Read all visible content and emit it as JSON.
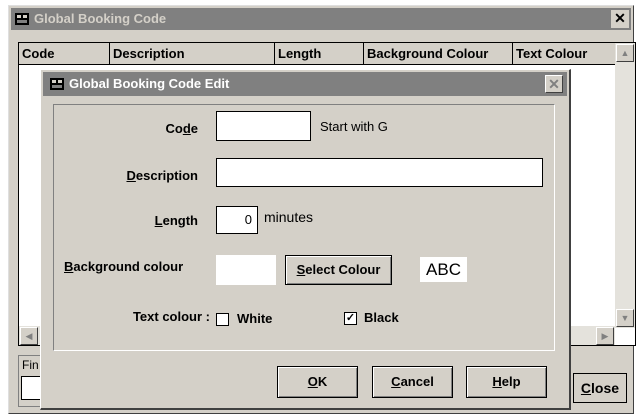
{
  "outer_window": {
    "title": "Global Booking Code",
    "close_glyph": "✕",
    "columns": [
      "Code",
      "Description",
      "Length",
      "Background Colour",
      "Text Colour"
    ],
    "find_label": "Fin",
    "close_button_label": "Close",
    "close_button_mnemonic": "C",
    "close_button_rest": "lose"
  },
  "dialog": {
    "title": "Global Booking Code Edit",
    "close_glyph": "✕",
    "code": {
      "label_pre": "Co",
      "label_mnemonic": "d",
      "label_post": "e",
      "value": "",
      "hint": "Start with G"
    },
    "description": {
      "label_mnemonic": "D",
      "label_post": "escription",
      "value": ""
    },
    "length": {
      "label_mnemonic": "L",
      "label_post": "ength",
      "value": "0",
      "unit": "minutes"
    },
    "background_colour": {
      "label_mnemonic": "B",
      "label_post": "ackground colour",
      "select_button_mnemonic": "S",
      "select_button_rest": "elect Colour",
      "preview_text": "ABC"
    },
    "text_colour": {
      "label": "Text colour :",
      "options": [
        {
          "label": "White",
          "checked": false
        },
        {
          "label": "Black",
          "checked": true
        }
      ]
    },
    "buttons": {
      "ok": {
        "mnemonic": "O",
        "rest": "K"
      },
      "cancel": {
        "mnemonic": "C",
        "rest": "ancel"
      },
      "help": {
        "mnemonic": "H",
        "rest": "elp"
      }
    }
  },
  "colors": {
    "title_bar_inactive": "#808080",
    "face": "#d4d0c8"
  }
}
